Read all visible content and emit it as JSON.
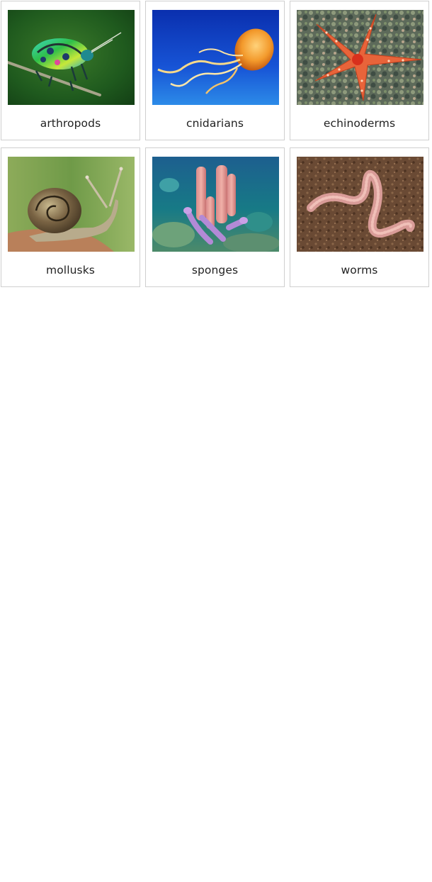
{
  "cards": [
    {
      "label": "arthropods",
      "icon": "beetle-photo"
    },
    {
      "label": "cnidarians",
      "icon": "jellyfish-photo"
    },
    {
      "label": "echinoderms",
      "icon": "starfish-photo"
    },
    {
      "label": "mollusks",
      "icon": "snail-photo"
    },
    {
      "label": "sponges",
      "icon": "sponge-photo"
    },
    {
      "label": "worms",
      "icon": "earthworm-photo"
    }
  ]
}
